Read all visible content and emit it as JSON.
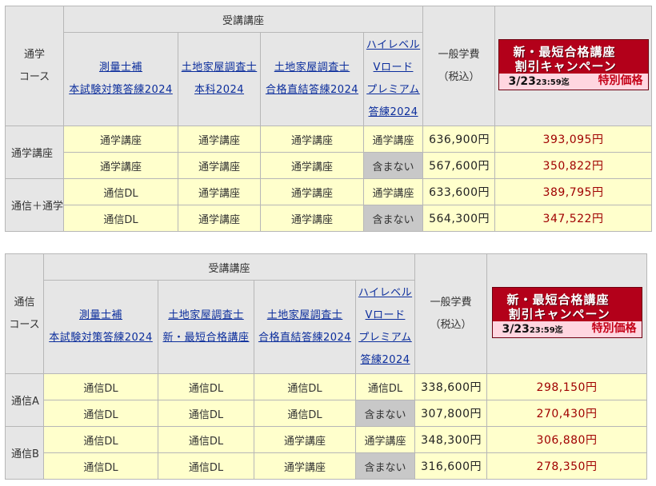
{
  "tables": [
    {
      "course_label": [
        "通学",
        "コース"
      ],
      "header_group": "受講講座",
      "columns": [
        {
          "lines": [
            "測量士補",
            "本試験対策答練2024"
          ]
        },
        {
          "lines": [
            "土地家屋調査士",
            "本科2024"
          ]
        },
        {
          "lines": [
            "土地家屋調査士",
            "合格直結答練2024"
          ]
        },
        {
          "lines": [
            "ハイレベル",
            "Vロード",
            "プレミアム",
            "答練2024"
          ]
        }
      ],
      "fee_label": [
        "一般学費",
        "（税込）"
      ],
      "banner": {
        "line1": "新・最短合格講座",
        "line2": "割引キャンペーン",
        "date": "3/23",
        "time": "23:59迄",
        "special": "特別価格"
      },
      "groups": [
        {
          "label": "通学講座",
          "rows": [
            {
              "c1": "通学講座",
              "c2": "通学講座",
              "c3": "通学講座",
              "c4": "通学講座",
              "c4_none": false,
              "price": "636,900円",
              "discount": "393,095円"
            },
            {
              "c1": "通学講座",
              "c2": "通学講座",
              "c3": "通学講座",
              "c4": "含まない",
              "c4_none": true,
              "price": "567,600円",
              "discount": "350,822円"
            }
          ]
        },
        {
          "label": "通信＋通学",
          "rows": [
            {
              "c1": "通信DL",
              "c2": "通学講座",
              "c3": "通学講座",
              "c4": "通学講座",
              "c4_none": false,
              "price": "633,600円",
              "discount": "389,795円"
            },
            {
              "c1": "通信DL",
              "c2": "通学講座",
              "c3": "通学講座",
              "c4": "含まない",
              "c4_none": true,
              "price": "564,300円",
              "discount": "347,522円"
            }
          ]
        }
      ]
    },
    {
      "course_label": [
        "通信",
        "コース"
      ],
      "header_group": "受講講座",
      "columns": [
        {
          "lines": [
            "測量士補",
            "本試験対策答練2024"
          ]
        },
        {
          "lines": [
            "土地家屋調査士",
            "新・最短合格講座"
          ]
        },
        {
          "lines": [
            "土地家屋調査士",
            "合格直結答練2024"
          ]
        },
        {
          "lines": [
            "ハイレベル",
            "Vロード",
            "プレミアム",
            "答練2024"
          ]
        }
      ],
      "fee_label": [
        "一般学費",
        "（税込）"
      ],
      "banner": {
        "line1": "新・最短合格講座",
        "line2": "割引キャンペーン",
        "date": "3/23",
        "time": "23:59迄",
        "special": "特別価格"
      },
      "groups": [
        {
          "label": "通信A",
          "rows": [
            {
              "c1": "通信DL",
              "c2": "通信DL",
              "c3": "通信DL",
              "c4": "通信DL",
              "c4_none": false,
              "price": "338,600円",
              "discount": "298,150円"
            },
            {
              "c1": "通信DL",
              "c2": "通信DL",
              "c3": "通信DL",
              "c4": "含まない",
              "c4_none": true,
              "price": "307,800円",
              "discount": "270,430円"
            }
          ]
        },
        {
          "label": "通信B",
          "rows": [
            {
              "c1": "通信DL",
              "c2": "通信DL",
              "c3": "通学講座",
              "c4": "通学講座",
              "c4_none": false,
              "price": "348,300円",
              "discount": "306,880円"
            },
            {
              "c1": "通信DL",
              "c2": "通信DL",
              "c3": "通学講座",
              "c4": "含まない",
              "c4_none": true,
              "price": "316,600円",
              "discount": "278,350円"
            }
          ]
        }
      ]
    }
  ]
}
